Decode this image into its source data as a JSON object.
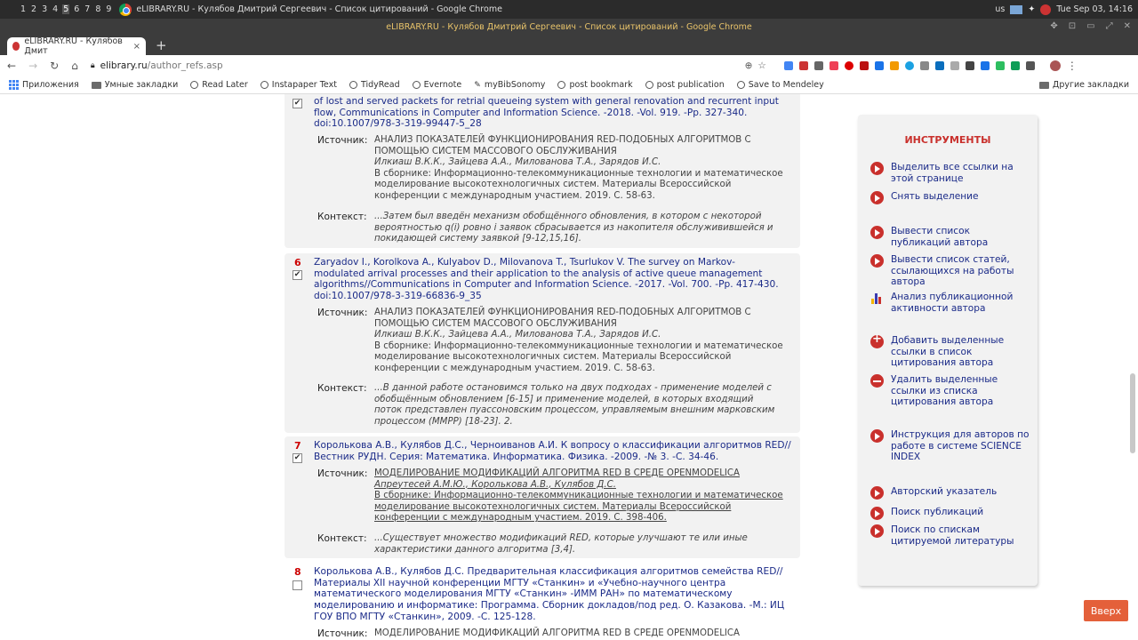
{
  "taskbar": {
    "workspaces": [
      "1",
      "2",
      "3",
      "4",
      "5",
      "6",
      "7",
      "8",
      "9"
    ],
    "active_title": "eLIBRARY.RU - Кулябов Дмитрий Сергеевич - Список цитирований - Google Chrome",
    "keyboard": "us",
    "clock": "Tue Sep 03, 14:16"
  },
  "window_title": "eLIBRARY.RU - Кулябов Дмитрий Сергеевич - Список цитирований - Google Chrome",
  "tab": {
    "label": "eLIBRARY.RU - Кулябов Дмит",
    "close": "×",
    "new": "+"
  },
  "address": {
    "host": "elibrary.ru",
    "path": "/author_refs.asp"
  },
  "bookmarks": {
    "items": [
      "Приложения",
      "Умные закладки",
      "Read Later",
      "Instapaper Text",
      "TidyRead",
      "Evernote",
      "myBibSonomy",
      "post bookmark",
      "post publication",
      "Save to Mendeley"
    ],
    "other": "Другие закладки"
  },
  "entries": [
    {
      "num": "",
      "checked": true,
      "ref_lines": [
        "of lost and served packets for retrial queueing system with general renovation and recurrent input",
        "flow, Communications in Computer and Information Science. -2018. -Vol. 919. -Pp. 327-340.",
        "doi:10.1007/978-3-319-99447-5_28"
      ],
      "source_label": "Источник:",
      "source_lines": [
        "АНАЛИЗ ПОКАЗАТЕЛЕЙ ФУНКЦИОНИРОВАНИЯ RED-ПОДОБНЫХ АЛГОРИТМОВ С",
        "ПОМОЩЬЮ СИСТЕМ МАССОВОГО ОБСЛУЖИВАНИЯ"
      ],
      "authors": "Илкиаш В.К.К., Зайцева А.А., Милованова Т.А., Зарядов И.С.",
      "collection_lines": [
        "В сборнике: Информационно-телекоммуникационные технологии и математическое",
        "моделирование высокотехнологичных систем. Материалы Всероссийской",
        "конференции с международным участием. 2019. С. 58-63."
      ],
      "context_label": "Контекст:",
      "context_lines": [
        "...Затем был введён механизм обобщённого обновления, в котором с некоторой",
        "вероятностью q(i) ровно i заявок сбрасывается из накопителя обслуживившейся и",
        "покидающей систему заявкой [9-12,15,16]."
      ]
    },
    {
      "num": "6",
      "checked": true,
      "ref_lines": [
        "Zaryadov I., Korolkova A., Kulyabov D., Milovanova T., Tsurlukov V. The survey on Markov-",
        "modulated arrival processes and their application to the analysis of active queue management",
        "algorithms//Communications in Computer and Information Science. -2017. -Vol. 700. -Pp. 417-430.",
        "doi:10.1007/978-3-319-66836-9_35"
      ],
      "source_label": "Источник:",
      "source_lines": [
        "АНАЛИЗ ПОКАЗАТЕЛЕЙ ФУНКЦИОНИРОВАНИЯ RED-ПОДОБНЫХ АЛГОРИТМОВ С",
        "ПОМОЩЬЮ СИСТЕМ МАССОВОГО ОБСЛУЖИВАНИЯ"
      ],
      "authors": "Илкиаш В.К.К., Зайцева А.А., Милованова Т.А., Зарядов И.С.",
      "collection_lines": [
        "В сборнике: Информационно-телекоммуникационные технологии и математическое",
        "моделирование высокотехнологичных систем. Материалы Всероссийской",
        "конференции с международным участием. 2019. С. 58-63."
      ],
      "context_label": "Контекст:",
      "context_lines": [
        "...В данной работе остановимся только на двух подходах - применение моделей с",
        "обобщённым обновлением [6-15] и применение моделей, в которых входящий",
        "поток представлен пуассоновским процессом, управляемым внешним марковским",
        "процессом (MMPP) [18-23]. 2."
      ]
    },
    {
      "num": "7",
      "checked": true,
      "ref_lines": [
        "Королькова А.В., Кулябов Д.С., Черноиванов А.И. К вопросу о классификации алгоритмов RED//",
        "Вестник РУДН. Серия: Математика. Информатика. Физика. -2009. -№ 3. -С. 34-46."
      ],
      "source_label": "Источник:",
      "source_lines": [
        "МОДЕЛИРОВАНИЕ МОДИФИКАЦИЙ АЛГОРИТМА RED В СРЕДЕ OPENMODELICA"
      ],
      "authors": "Апреутесей А.М.Ю., Королькова А.В., Кулябов Д.С.",
      "collection_lines": [
        "В сборнике: Информационно-телекоммуникационные технологии и математическое",
        "моделирование высокотехнологичных систем. Материалы Всероссийской",
        "конференции с международным участием. 2019. С. 398-406."
      ],
      "context_label": "Контекст:",
      "context_lines": [
        "...Существует множество модификаций RED, которые улучшают те или иные",
        "характеристики данного алгоритма [3,4]."
      ]
    },
    {
      "num": "8",
      "checked": false,
      "ref_lines": [
        "Королькова А.В., Кулябов Д.С. Предварительная классификация алгоритмов семейства RED//",
        "Материалы XII научной конференции МГТУ «Станкин» и «Учебно-научного центра",
        "математического моделирования МГТУ «Станкин» -ИММ РАН» по математическому",
        "моделированию и информатике: Программа. Сборник докладов/под ред. О. Казакова. -М.: ИЦ",
        "ГОУ ВПО МГТУ «Станкин», 2009. -С. 125-128."
      ],
      "source_label": "Источник:",
      "source_lines": [
        "МОДЕЛИРОВАНИЕ МОДИФИКАЦИЙ АЛГОРИТМА RED В СРЕДЕ OPENMODELICA"
      ]
    }
  ],
  "tools": {
    "heading": "ИНСТРУМЕНТЫ",
    "items": [
      {
        "lines": [
          "Выделить все ссылки на",
          "этой странице"
        ],
        "icon": "play-icon"
      },
      {
        "lines": [
          "Снять выделение"
        ],
        "icon": "play-icon"
      },
      {
        "lines": [
          "Вывести список",
          "публикаций автора"
        ],
        "icon": "play-icon"
      },
      {
        "lines": [
          "Вывести список статей,",
          "ссылающихся на работы",
          "автора"
        ],
        "icon": "play-icon"
      },
      {
        "lines": [
          "Анализ публикационной",
          "активности автора"
        ],
        "icon": "bar-chart-icon"
      },
      {
        "lines": [
          "Добавить выделенные",
          "ссылки в список",
          "цитирования автора"
        ],
        "icon": "plus-icon"
      },
      {
        "lines": [
          "Удалить выделенные",
          "ссылки из списка",
          "цитирования автора"
        ],
        "icon": "minus-icon"
      },
      {
        "lines": [
          "Инструкция для авторов по",
          "работе в системе SCIENCE",
          "INDEX"
        ],
        "icon": "play-icon"
      },
      {
        "lines": [
          "Авторский указатель"
        ],
        "icon": "play-icon"
      },
      {
        "lines": [
          "Поиск публикаций"
        ],
        "icon": "play-icon"
      },
      {
        "lines": [
          "Поиск по спискам",
          "цитируемой литературы"
        ],
        "icon": "play-icon"
      }
    ]
  },
  "up_button": "Вверх",
  "colors": {
    "accent": "#c9302c",
    "link": "#1a2a88",
    "panel": "#f2f2f2",
    "up": "#e4603a"
  }
}
